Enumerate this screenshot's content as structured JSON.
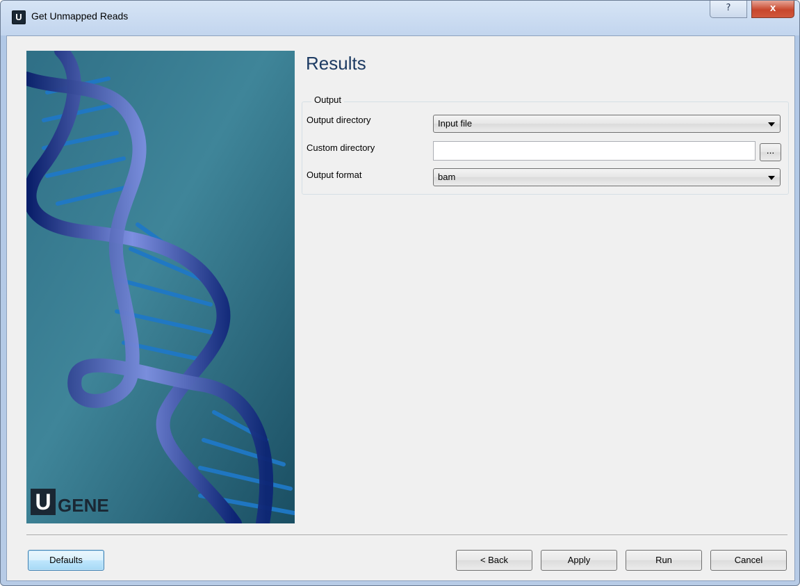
{
  "window": {
    "title": "Get Unmapped Reads",
    "app_icon_letter": "U",
    "help_label": "?",
    "close_label": "x"
  },
  "page": {
    "title": "Results"
  },
  "output_group": {
    "label": "Output",
    "output_directory": {
      "label": "Output directory",
      "value": "Input file"
    },
    "custom_directory": {
      "label": "Custom directory",
      "value": "",
      "browse_label": "..."
    },
    "output_format": {
      "label": "Output format",
      "value": "bam"
    }
  },
  "banner": {
    "logo_letter": "U",
    "logo_text": "GENE"
  },
  "buttons": {
    "defaults": "Defaults",
    "back": "< Back",
    "apply": "Apply",
    "run": "Run",
    "cancel": "Cancel"
  }
}
